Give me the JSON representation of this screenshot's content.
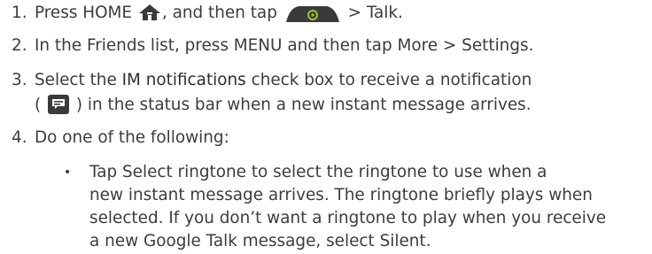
{
  "steps": [
    {
      "number": "1.",
      "parts": {
        "a": "Press HOME ",
        "b": ", and then tap ",
        "c": " > Talk."
      },
      "icons": [
        "home-icon",
        "app-launcher-tab-icon"
      ]
    },
    {
      "number": "2.",
      "text": "In the Friends list, press MENU and then tap More > Settings."
    },
    {
      "number": "3.",
      "line1_a": "Select the ",
      "line1_b": "IM notifications",
      "line1_c": " check box to receive a notification",
      "line2_a": "( ",
      "line2_b": " ) in the status bar when a new instant message arrives.",
      "icons": [
        "chat-notification-icon"
      ]
    },
    {
      "number": "4.",
      "text": "Do one of the following:"
    }
  ],
  "sub_bullet": {
    "bullet": "•",
    "lines": [
      "Tap Select ringtone to select the ringtone to use when a",
      "new instant message arrives. The ringtone briefly plays when",
      "selected. If you don’t want a ringtone to play when you receive",
      "a new Google Talk message, select Silent."
    ]
  },
  "colors": {
    "text": "#3c3c3c",
    "icon_dark": "#3a3a3a",
    "icon_green": "#9ec23b"
  }
}
